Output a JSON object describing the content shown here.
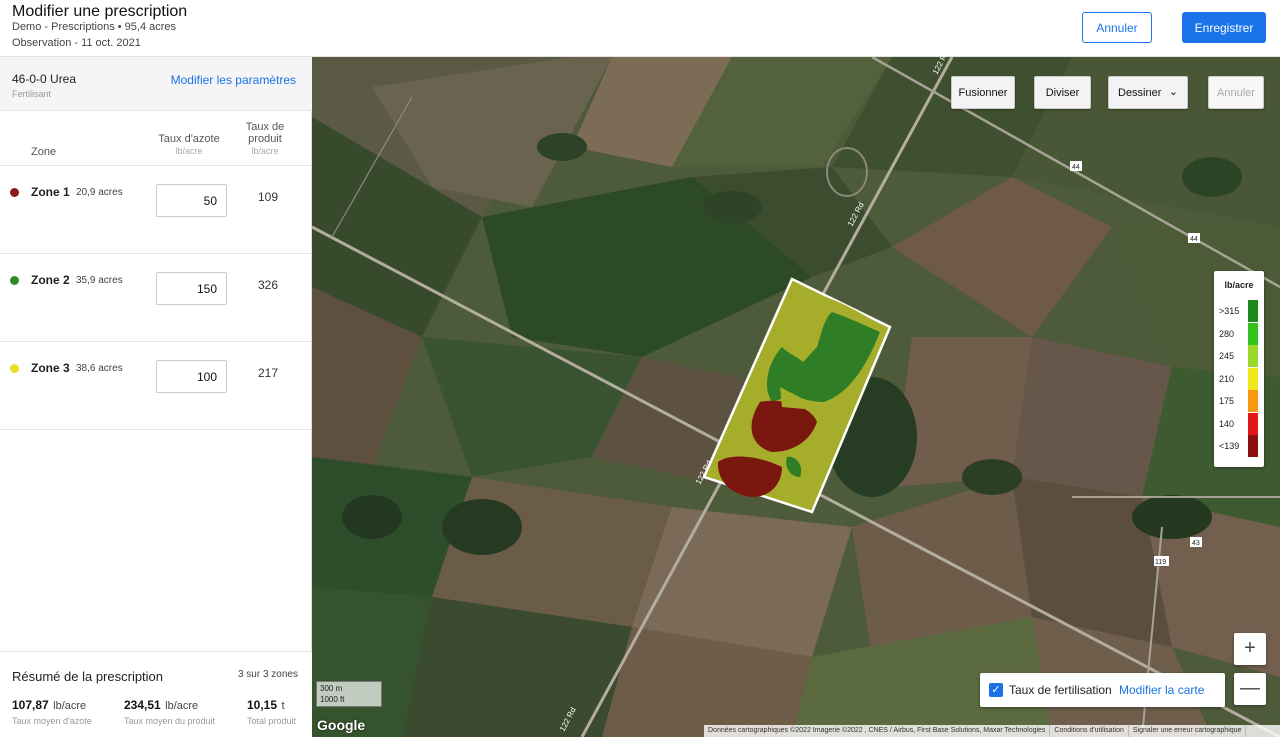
{
  "header": {
    "title": "Modifier une prescription",
    "subtitle": "Demo - Prescriptions • 95,4 acres",
    "observation": "Observation - 11 oct. 2021",
    "cancel_label": "Annuler",
    "save_label": "Enregistrer"
  },
  "fertilizer": {
    "name": "46-0-0 Urea",
    "type": "Fertilisant",
    "edit_link": "Modifier les paramètres"
  },
  "table": {
    "col_zone": "Zone",
    "col_nitrogen": "Taux d'azote",
    "col_nitrogen_unit": "lb/acre",
    "col_product_line1": "Taux de",
    "col_product_line2": "produit",
    "col_product_unit": "lb/acre"
  },
  "zones": [
    {
      "name": "Zone 1",
      "area": "20,9 acres",
      "nitrogen_rate": "50",
      "product_rate": "109",
      "color": "#8b1a1a"
    },
    {
      "name": "Zone 2",
      "area": "35,9 acres",
      "nitrogen_rate": "150",
      "product_rate": "326",
      "color": "#2e8b2e"
    },
    {
      "name": "Zone 3",
      "area": "38,6 acres",
      "nitrogen_rate": "100",
      "product_rate": "217",
      "color": "#e8e020"
    }
  ],
  "summary": {
    "title": "Résumé de la prescription",
    "zone_count": "3 sur 3 zones",
    "stats": [
      {
        "value": "107,87",
        "unit": "lb/acre",
        "label": "Taux moyen d'azote"
      },
      {
        "value": "234,51",
        "unit": "lb/acre",
        "label": "Taux moyen du produit"
      },
      {
        "value": "10,15",
        "unit": "t",
        "label": "Total produit"
      }
    ]
  },
  "map_toolbar": {
    "merge_label": "Fusionner",
    "split_label": "Diviser",
    "draw_label": "Dessiner",
    "undo_label": "Annuler"
  },
  "legend": {
    "title": "lb/acre",
    "entries": [
      {
        "label": ">315",
        "color": "#1e8a1e"
      },
      {
        "label": "280",
        "color": "#34c21c"
      },
      {
        "label": "245",
        "color": "#9ad92a"
      },
      {
        "label": "210",
        "color": "#f0e81c"
      },
      {
        "label": "175",
        "color": "#f59a12"
      },
      {
        "label": "140",
        "color": "#e01818"
      },
      {
        "label": "<139",
        "color": "#8c1010"
      }
    ]
  },
  "map_labels": {
    "road_122": "122 Rd",
    "road_44a": "44",
    "road_44b": "44",
    "road_43": "43",
    "road_119": "119",
    "scale_m": "300 m",
    "scale_ft": "1000 ft",
    "google": "Google"
  },
  "rate_toggle": {
    "label": "Taux de fertilisation",
    "link": "Modifier la carte",
    "checked": true
  },
  "zoom": {
    "in": "+",
    "out": "—"
  },
  "attribution": [
    "Données cartographiques ©2022 Imagerie ©2022 , CNES / Airbus, First Base Solutions, Maxar Technologies",
    "Conditions d'utilisation",
    "Signaler une erreur cartographique"
  ]
}
